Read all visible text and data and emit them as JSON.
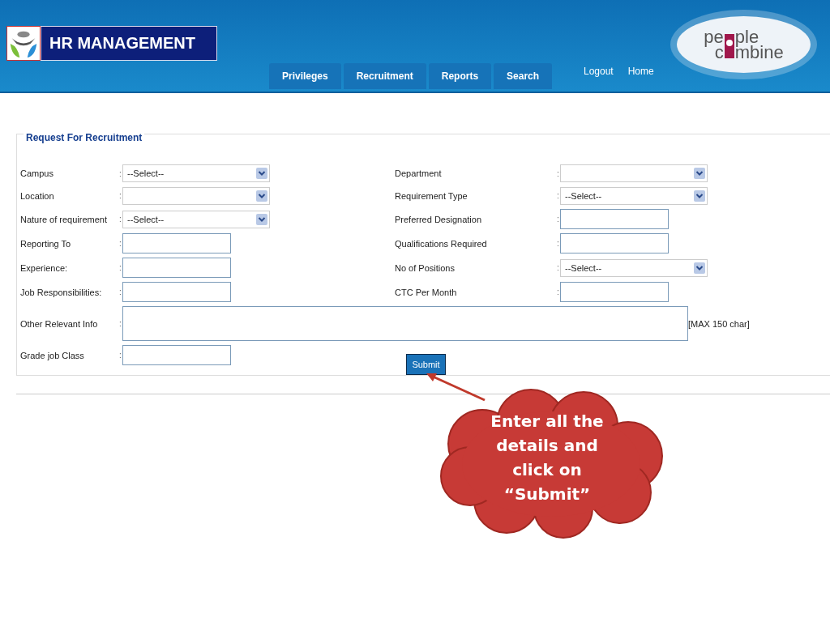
{
  "header": {
    "app_title": "HR MANAGEMENT",
    "tabs": [
      {
        "label": "Privileges",
        "selected": false
      },
      {
        "label": "Recruitment",
        "selected": false
      },
      {
        "label": "Reports",
        "selected": false
      },
      {
        "label": "Search",
        "selected": false
      }
    ],
    "links": [
      "Logout",
      "Home"
    ],
    "brand_lines": [
      {
        "before": "pe",
        "after": "ple"
      },
      {
        "before": "c",
        "after": "mbine"
      }
    ]
  },
  "form": {
    "legend": "Request For Recruitment",
    "separator": ":",
    "rows": [
      [
        {
          "label": "Campus",
          "kind": "select",
          "value": "--Select--"
        },
        {
          "label": "Department",
          "kind": "select"
        }
      ],
      [
        {
          "label": "Location",
          "kind": "select"
        },
        {
          "label": "Requirement Type",
          "kind": "select",
          "value": "--Select--"
        }
      ],
      [
        {
          "label": "Nature of requirement",
          "kind": "select",
          "value": "--Select--"
        },
        {
          "label": "Preferred Designation",
          "kind": "text"
        }
      ],
      [
        {
          "label": "Reporting To",
          "kind": "text"
        },
        {
          "label": "Qualifications Required",
          "kind": "text"
        }
      ],
      [
        {
          "label": "Experience:",
          "kind": "text"
        },
        {
          "label": "No of Positions",
          "kind": "select",
          "value": "--Select--"
        }
      ],
      [
        {
          "label": "Job Responsibilities:",
          "kind": "text"
        },
        {
          "label": "CTC Per Month",
          "kind": "text"
        }
      ],
      [
        {
          "label": "Other Relevant Info",
          "kind": "textarea",
          "note": "[MAX 150 char]"
        }
      ],
      [
        {
          "label": "Grade job Class",
          "kind": "text"
        }
      ]
    ],
    "submit": "Submit"
  },
  "callout": {
    "text": "Enter all the details and click on “Submit”"
  }
}
